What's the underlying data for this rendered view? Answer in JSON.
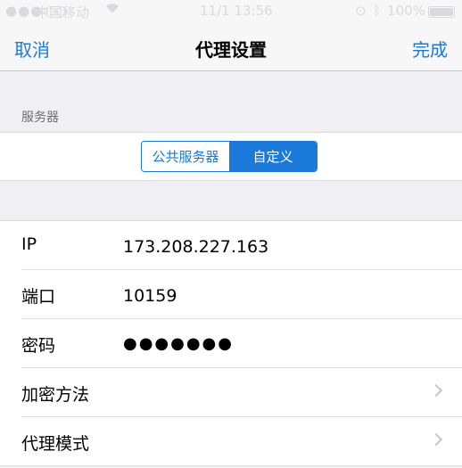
{
  "status_bar": {
    "signal": "●●●○○",
    "carrier": "中国移动",
    "wifi_icon": "wifi-icon",
    "time": "11/1 13:56",
    "battery": "100%"
  },
  "nav": {
    "cancel": "取消",
    "title": "代理设置",
    "done": "完成"
  },
  "server_section": {
    "header": "服务器",
    "segments": [
      "公共服务器",
      "自定义"
    ],
    "selected": "自定义"
  },
  "form": {
    "rows": [
      {
        "label": "IP",
        "value": "173.208.227.163"
      },
      {
        "label": "端口",
        "value": "10159"
      },
      {
        "label": "密码",
        "value": "●●●●●●●"
      },
      {
        "label": "加密方法",
        "value": ""
      },
      {
        "label": "代理模式",
        "value": ""
      }
    ]
  },
  "colors": {
    "accent": "#1a7ad9",
    "background": "#efeff4"
  }
}
